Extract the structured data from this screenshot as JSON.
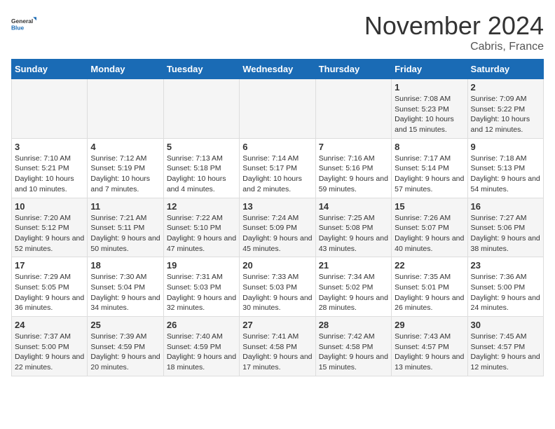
{
  "logo": {
    "line1": "General",
    "line2": "Blue"
  },
  "title": "November 2024",
  "subtitle": "Cabris, France",
  "days_header": [
    "Sunday",
    "Monday",
    "Tuesday",
    "Wednesday",
    "Thursday",
    "Friday",
    "Saturday"
  ],
  "weeks": [
    [
      {
        "day": "",
        "info": ""
      },
      {
        "day": "",
        "info": ""
      },
      {
        "day": "",
        "info": ""
      },
      {
        "day": "",
        "info": ""
      },
      {
        "day": "",
        "info": ""
      },
      {
        "day": "1",
        "info": "Sunrise: 7:08 AM\nSunset: 5:23 PM\nDaylight: 10 hours and 15 minutes."
      },
      {
        "day": "2",
        "info": "Sunrise: 7:09 AM\nSunset: 5:22 PM\nDaylight: 10 hours and 12 minutes."
      }
    ],
    [
      {
        "day": "3",
        "info": "Sunrise: 7:10 AM\nSunset: 5:21 PM\nDaylight: 10 hours and 10 minutes."
      },
      {
        "day": "4",
        "info": "Sunrise: 7:12 AM\nSunset: 5:19 PM\nDaylight: 10 hours and 7 minutes."
      },
      {
        "day": "5",
        "info": "Sunrise: 7:13 AM\nSunset: 5:18 PM\nDaylight: 10 hours and 4 minutes."
      },
      {
        "day": "6",
        "info": "Sunrise: 7:14 AM\nSunset: 5:17 PM\nDaylight: 10 hours and 2 minutes."
      },
      {
        "day": "7",
        "info": "Sunrise: 7:16 AM\nSunset: 5:16 PM\nDaylight: 9 hours and 59 minutes."
      },
      {
        "day": "8",
        "info": "Sunrise: 7:17 AM\nSunset: 5:14 PM\nDaylight: 9 hours and 57 minutes."
      },
      {
        "day": "9",
        "info": "Sunrise: 7:18 AM\nSunset: 5:13 PM\nDaylight: 9 hours and 54 minutes."
      }
    ],
    [
      {
        "day": "10",
        "info": "Sunrise: 7:20 AM\nSunset: 5:12 PM\nDaylight: 9 hours and 52 minutes."
      },
      {
        "day": "11",
        "info": "Sunrise: 7:21 AM\nSunset: 5:11 PM\nDaylight: 9 hours and 50 minutes."
      },
      {
        "day": "12",
        "info": "Sunrise: 7:22 AM\nSunset: 5:10 PM\nDaylight: 9 hours and 47 minutes."
      },
      {
        "day": "13",
        "info": "Sunrise: 7:24 AM\nSunset: 5:09 PM\nDaylight: 9 hours and 45 minutes."
      },
      {
        "day": "14",
        "info": "Sunrise: 7:25 AM\nSunset: 5:08 PM\nDaylight: 9 hours and 43 minutes."
      },
      {
        "day": "15",
        "info": "Sunrise: 7:26 AM\nSunset: 5:07 PM\nDaylight: 9 hours and 40 minutes."
      },
      {
        "day": "16",
        "info": "Sunrise: 7:27 AM\nSunset: 5:06 PM\nDaylight: 9 hours and 38 minutes."
      }
    ],
    [
      {
        "day": "17",
        "info": "Sunrise: 7:29 AM\nSunset: 5:05 PM\nDaylight: 9 hours and 36 minutes."
      },
      {
        "day": "18",
        "info": "Sunrise: 7:30 AM\nSunset: 5:04 PM\nDaylight: 9 hours and 34 minutes."
      },
      {
        "day": "19",
        "info": "Sunrise: 7:31 AM\nSunset: 5:03 PM\nDaylight: 9 hours and 32 minutes."
      },
      {
        "day": "20",
        "info": "Sunrise: 7:33 AM\nSunset: 5:03 PM\nDaylight: 9 hours and 30 minutes."
      },
      {
        "day": "21",
        "info": "Sunrise: 7:34 AM\nSunset: 5:02 PM\nDaylight: 9 hours and 28 minutes."
      },
      {
        "day": "22",
        "info": "Sunrise: 7:35 AM\nSunset: 5:01 PM\nDaylight: 9 hours and 26 minutes."
      },
      {
        "day": "23",
        "info": "Sunrise: 7:36 AM\nSunset: 5:00 PM\nDaylight: 9 hours and 24 minutes."
      }
    ],
    [
      {
        "day": "24",
        "info": "Sunrise: 7:37 AM\nSunset: 5:00 PM\nDaylight: 9 hours and 22 minutes."
      },
      {
        "day": "25",
        "info": "Sunrise: 7:39 AM\nSunset: 4:59 PM\nDaylight: 9 hours and 20 minutes."
      },
      {
        "day": "26",
        "info": "Sunrise: 7:40 AM\nSunset: 4:59 PM\nDaylight: 9 hours and 18 minutes."
      },
      {
        "day": "27",
        "info": "Sunrise: 7:41 AM\nSunset: 4:58 PM\nDaylight: 9 hours and 17 minutes."
      },
      {
        "day": "28",
        "info": "Sunrise: 7:42 AM\nSunset: 4:58 PM\nDaylight: 9 hours and 15 minutes."
      },
      {
        "day": "29",
        "info": "Sunrise: 7:43 AM\nSunset: 4:57 PM\nDaylight: 9 hours and 13 minutes."
      },
      {
        "day": "30",
        "info": "Sunrise: 7:45 AM\nSunset: 4:57 PM\nDaylight: 9 hours and 12 minutes."
      }
    ]
  ]
}
